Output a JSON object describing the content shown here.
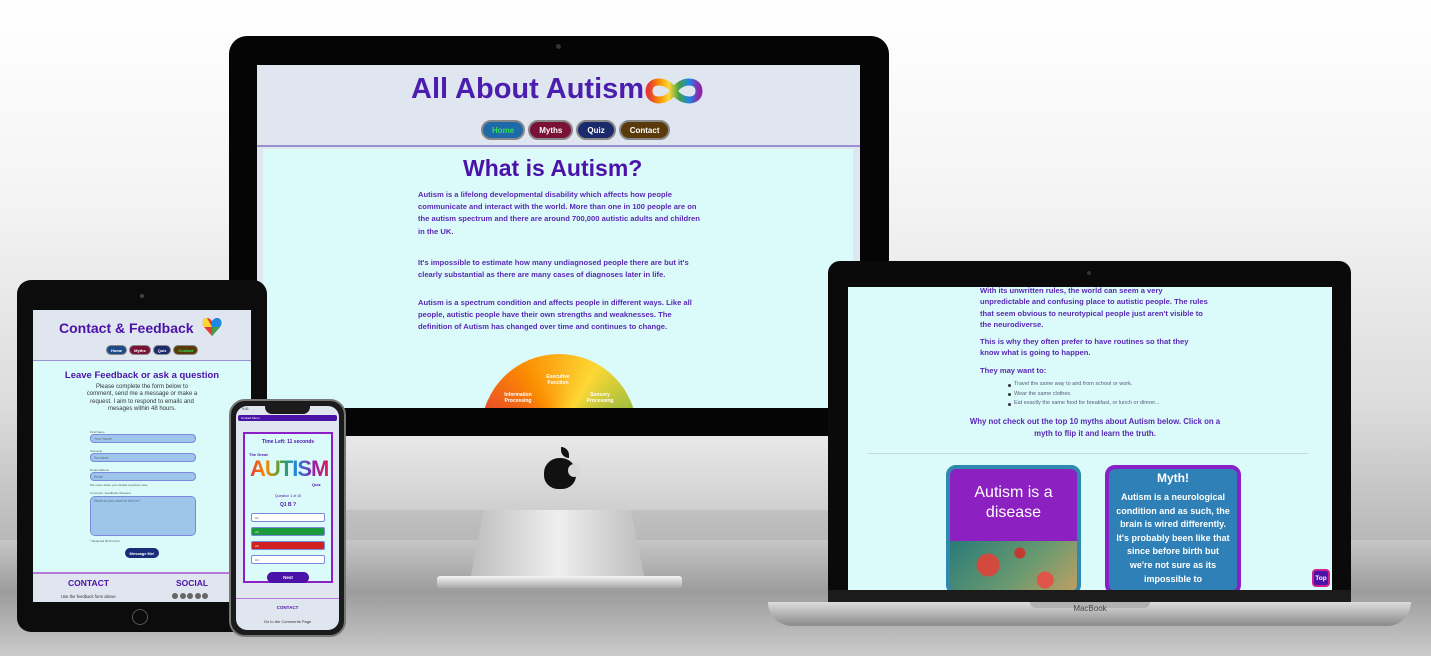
{
  "desktop": {
    "site_title": "All About Autism",
    "nav": [
      "Home",
      "Myths",
      "Quiz",
      "Contact"
    ],
    "heading": "What is Autism?",
    "paragraphs": [
      "Autism is a lifelong developmental disability which affects how people communicate and interact with the world. More than one in 100 people are on the autism spectrum and there are around 700,000 autistic adults and children in the UK.",
      "It's impossible to estimate how many undiagnosed people there are but it's clearly substantial as there are many cases of diagnoses later in life.",
      "Autism is a spectrum condition and affects people in different ways. Like all people, autistic people have their own strengths and weaknesses. The definition of Autism has changed over time and continues to change."
    ],
    "spectrum_labels": [
      "Executive Function",
      "Information Processing",
      "Sensory Processing"
    ]
  },
  "laptop": {
    "para1": "With its unwritten rules, the world can seem a very unpredictable and confusing place to autistic people. The rules that seem obvious to neurotypical people just aren't visible to the neurodiverse.",
    "para2": "This is why they often prefer to have routines so that they know what is going to happen.",
    "para3": "They may want to:",
    "list": [
      "Travel the same way to and from school or work.",
      "Wear the same clothes.",
      "Eat exactly the same food for breakfast, or lunch or dinner..."
    ],
    "cta": "Why not check out the top 10 myths about Autism below. Click on a myth to flip it and learn the truth.",
    "card_front": "Autism is a disease",
    "card_back_title": "Myth!",
    "card_back_text": "Autism is a neurological condition and as such, the brain is wired differently. It's probably been like that since before birth but we're not sure as its impossible to",
    "top_button": "Top",
    "brand": "MacBook"
  },
  "tablet": {
    "title": "Contact & Feedback",
    "nav": [
      "Home",
      "Myths",
      "Quiz",
      "Contact"
    ],
    "heading": "Leave Feedback or ask a question",
    "intro": "Please complete the form below to comment, send me a message or make a request. I aim to respond to emails and mesages within 48 hours.",
    "labels": [
      "First Name",
      "Surname",
      "Email address",
      "Comment, Feedback, Request",
      "We never share your details anywhere else"
    ],
    "placeholders": [
      "Your Name",
      "Surname",
      "Email",
      "What do you want to tell me?"
    ],
    "required_note": "* Required fill this form",
    "send_label": "Message Me!",
    "footer_contact": "CONTACT",
    "footer_social": "SOCIAL",
    "footer_text": "Use the feedback form above"
  },
  "phone": {
    "status_time": "9:41",
    "bar_text": "Contact Menu",
    "timer": "Time Left: 11 seconds",
    "the_great": "The Great",
    "autism_word": "AUTISM",
    "quiz_word": "Quiz",
    "question_count": "Question 1 of 10",
    "question": "Q1 B ?",
    "answers": [
      "A1",
      "A2",
      "A3",
      "A4"
    ],
    "answer_colors": [
      "#ffffff",
      "#1a9a3a",
      "#d02020",
      "#ffffff"
    ],
    "next_label": "Next",
    "footer_contact": "CONTACT",
    "footer_text": "Go to the Comments Page"
  }
}
